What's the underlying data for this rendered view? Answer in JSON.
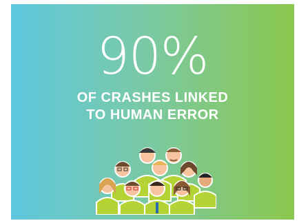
{
  "headline": "90%",
  "subline": {
    "line1": "OF CRASHES LINKED",
    "line2": "TO HUMAN ERROR"
  },
  "colors": {
    "gradient_left": "#5ec8e0",
    "gradient_right": "#8cc84d",
    "text": "#ffffff",
    "jacket": "#b5d334",
    "skin": "#f7c4a0"
  },
  "illustration": "group-of-people-icon"
}
